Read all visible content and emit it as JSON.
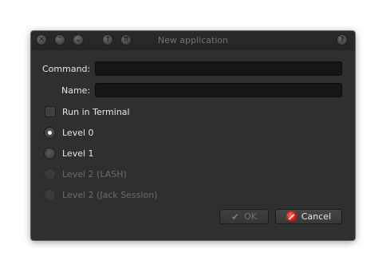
{
  "window": {
    "title": "New application",
    "controls": {
      "close": "✕",
      "minimize": "⌃",
      "maximize": "⌄",
      "shade_a": "↑",
      "shade_b": "⇈",
      "help": "?"
    }
  },
  "form": {
    "command_label": "Command:",
    "command_value": "",
    "name_label": "Name:",
    "name_value": "",
    "run_in_terminal_label": "Run in Terminal",
    "run_in_terminal_checked": false
  },
  "levels": [
    {
      "label": "Level 0",
      "selected": true,
      "enabled": true
    },
    {
      "label": "Level 1",
      "selected": false,
      "enabled": true
    },
    {
      "label": "Level 2 (LASH)",
      "selected": false,
      "enabled": false
    },
    {
      "label": "Level 2 (Jack Session)",
      "selected": false,
      "enabled": false
    }
  ],
  "buttons": {
    "ok_label": "OK",
    "ok_enabled": false,
    "ok_icon": "checkmark-icon",
    "cancel_label": "Cancel",
    "cancel_icon": "cancel-icon"
  },
  "colors": {
    "window_bg": "#2f2f2f",
    "field_bg": "#161616",
    "cancel_icon": "#d01414"
  }
}
